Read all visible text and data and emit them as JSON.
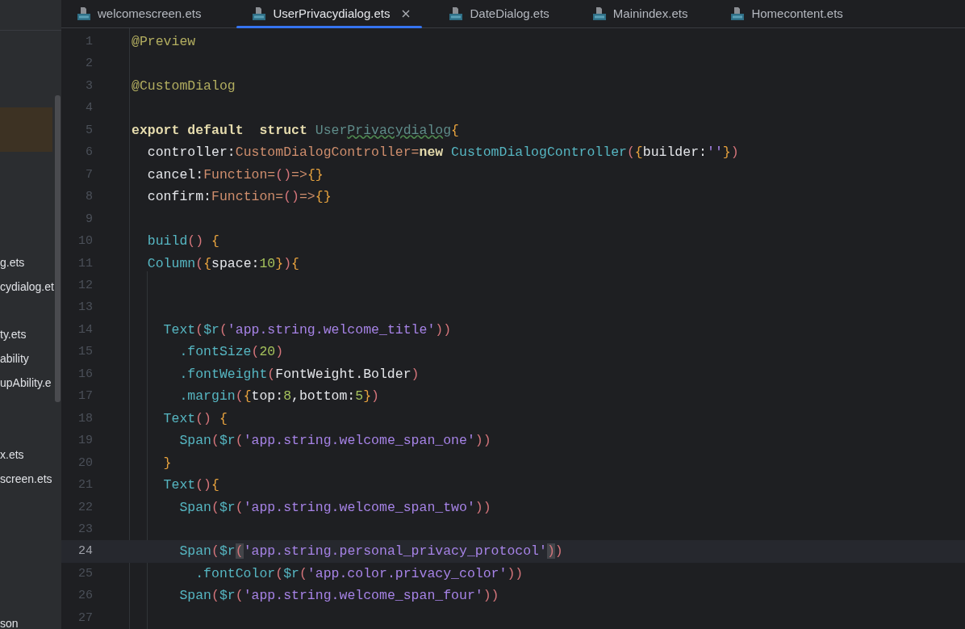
{
  "tabs": [
    {
      "label": "welcomescreen.ets",
      "selected": false
    },
    {
      "label": "UserPrivacydialog.ets",
      "selected": true
    },
    {
      "label": "DateDialog.ets",
      "selected": false
    },
    {
      "label": "Mainindex.ets",
      "selected": false
    },
    {
      "label": "Homecontent.ets",
      "selected": false
    }
  ],
  "sidebar": {
    "items": [
      {
        "label": "g.ets"
      },
      {
        "label": "cydialog.et"
      },
      {
        "label": "ty.ets"
      },
      {
        "label": "ability"
      },
      {
        "label": "upAbility.e"
      },
      {
        "label": "x.ets"
      },
      {
        "label": "screen.ets"
      },
      {
        "label": "son"
      }
    ]
  },
  "editor": {
    "lines": [
      {
        "number": "1",
        "current": false,
        "tokens": [
          {
            "text": "@Preview",
            "kind": "ann"
          }
        ]
      },
      {
        "number": "2",
        "current": false
      },
      {
        "number": "3",
        "current": false,
        "tokens": [
          {
            "text": "@CustomDialog",
            "kind": "ann"
          }
        ]
      },
      {
        "number": "4",
        "current": false
      },
      {
        "number": "5",
        "current": false,
        "tokens": [
          {
            "text": "export default  struct",
            "kind": "kw"
          },
          {
            "text": " User",
            "kind": "cls"
          },
          {
            "text": "Privacydialog",
            "kind": "warn"
          },
          {
            "text": "{",
            "kind": "brace"
          }
        ]
      },
      {
        "number": "6",
        "current": false,
        "tokens": [
          {
            "text": "  controller:",
            "kind": "plain"
          },
          {
            "text": "CustomDialogController",
            "kind": "type"
          },
          {
            "text": "=",
            "kind": "op"
          },
          {
            "text": "new",
            "kind": "kw"
          },
          {
            "text": " CustomDialogController",
            "kind": "fn"
          },
          {
            "text": "(",
            "kind": "paren"
          },
          {
            "text": "{",
            "kind": "brace"
          },
          {
            "text": "builder:",
            "kind": "plain"
          },
          {
            "text": "''",
            "kind": "str"
          },
          {
            "text": "}",
            "kind": "brace"
          },
          {
            "text": ")",
            "kind": "paren"
          }
        ]
      },
      {
        "number": "7",
        "current": false,
        "tokens": [
          {
            "text": "  cancel:",
            "kind": "plain"
          },
          {
            "text": "Function",
            "kind": "type"
          },
          {
            "text": "=",
            "kind": "op"
          },
          {
            "text": "()",
            "kind": "paren"
          },
          {
            "text": "=>",
            "kind": "op"
          },
          {
            "text": "{}",
            "kind": "brace"
          }
        ]
      },
      {
        "number": "8",
        "current": false,
        "tokens": [
          {
            "text": "  confirm:",
            "kind": "plain"
          },
          {
            "text": "Function",
            "kind": "type"
          },
          {
            "text": "=",
            "kind": "op"
          },
          {
            "text": "()",
            "kind": "paren"
          },
          {
            "text": "=>",
            "kind": "op"
          },
          {
            "text": "{}",
            "kind": "brace"
          }
        ]
      },
      {
        "number": "9",
        "current": false
      },
      {
        "number": "10",
        "current": false,
        "tokens": [
          {
            "text": "  build",
            "kind": "fn"
          },
          {
            "text": "()",
            "kind": "paren"
          },
          {
            "text": " {",
            "kind": "brace"
          }
        ]
      },
      {
        "number": "11",
        "current": false,
        "tokens": [
          {
            "text": "  Column",
            "kind": "fn"
          },
          {
            "text": "(",
            "kind": "paren"
          },
          {
            "text": "{",
            "kind": "brace"
          },
          {
            "text": "space:",
            "kind": "plain"
          },
          {
            "text": "10",
            "kind": "num"
          },
          {
            "text": "}",
            "kind": "brace"
          },
          {
            "text": ")",
            "kind": "paren"
          },
          {
            "text": "{",
            "kind": "brace"
          }
        ]
      },
      {
        "number": "12",
        "current": false
      },
      {
        "number": "13",
        "current": false
      },
      {
        "number": "14",
        "current": false,
        "tokens": [
          {
            "text": "    Text",
            "kind": "fn"
          },
          {
            "text": "(",
            "kind": "paren"
          },
          {
            "text": "$r",
            "kind": "fn"
          },
          {
            "text": "(",
            "kind": "paren"
          },
          {
            "text": "'app.string.welcome_title'",
            "kind": "str"
          },
          {
            "text": "))",
            "kind": "paren"
          }
        ]
      },
      {
        "number": "15",
        "current": false,
        "tokens": [
          {
            "text": "      .fontSize",
            "kind": "fn"
          },
          {
            "text": "(",
            "kind": "paren"
          },
          {
            "text": "20",
            "kind": "num"
          },
          {
            "text": ")",
            "kind": "paren"
          }
        ]
      },
      {
        "number": "16",
        "current": false,
        "tokens": [
          {
            "text": "      .fontWeight",
            "kind": "fn"
          },
          {
            "text": "(",
            "kind": "paren"
          },
          {
            "text": "FontWeight.Bolder",
            "kind": "plain"
          },
          {
            "text": ")",
            "kind": "paren"
          }
        ]
      },
      {
        "number": "17",
        "current": false,
        "tokens": [
          {
            "text": "      .margin",
            "kind": "fn"
          },
          {
            "text": "(",
            "kind": "paren"
          },
          {
            "text": "{",
            "kind": "brace"
          },
          {
            "text": "top:",
            "kind": "plain"
          },
          {
            "text": "8",
            "kind": "num"
          },
          {
            "text": ",bottom:",
            "kind": "plain"
          },
          {
            "text": "5",
            "kind": "num"
          },
          {
            "text": "}",
            "kind": "brace"
          },
          {
            "text": ")",
            "kind": "paren"
          }
        ]
      },
      {
        "number": "18",
        "current": false,
        "tokens": [
          {
            "text": "    Text",
            "kind": "fn"
          },
          {
            "text": "()",
            "kind": "paren"
          },
          {
            "text": " {",
            "kind": "brace"
          }
        ]
      },
      {
        "number": "19",
        "current": false,
        "tokens": [
          {
            "text": "      Span",
            "kind": "fn"
          },
          {
            "text": "(",
            "kind": "paren"
          },
          {
            "text": "$r",
            "kind": "fn"
          },
          {
            "text": "(",
            "kind": "paren"
          },
          {
            "text": "'app.string.welcome_span_one'",
            "kind": "str"
          },
          {
            "text": "))",
            "kind": "paren"
          }
        ]
      },
      {
        "number": "20",
        "current": false,
        "tokens": [
          {
            "text": "    }",
            "kind": "brace"
          }
        ]
      },
      {
        "number": "21",
        "current": false,
        "tokens": [
          {
            "text": "    Text",
            "kind": "fn"
          },
          {
            "text": "()",
            "kind": "paren"
          },
          {
            "text": "{",
            "kind": "brace"
          }
        ]
      },
      {
        "number": "22",
        "current": false,
        "tokens": [
          {
            "text": "      Span",
            "kind": "fn"
          },
          {
            "text": "(",
            "kind": "paren"
          },
          {
            "text": "$r",
            "kind": "fn"
          },
          {
            "text": "(",
            "kind": "paren"
          },
          {
            "text": "'app.string.welcome_span_two'",
            "kind": "str"
          },
          {
            "text": "))",
            "kind": "paren"
          }
        ]
      },
      {
        "number": "23",
        "current": false
      },
      {
        "number": "24",
        "current": true,
        "tokens": [
          {
            "text": "      Span",
            "kind": "fn"
          },
          {
            "text": "(",
            "kind": "paren"
          },
          {
            "text": "$r",
            "kind": "fn"
          },
          {
            "text": "(",
            "kind": "match"
          },
          {
            "text": "'app.string.personal_privacy_protocol'",
            "kind": "str"
          },
          {
            "text": ")",
            "kind": "match"
          },
          {
            "text": ")",
            "kind": "paren"
          }
        ]
      },
      {
        "number": "25",
        "current": false,
        "tokens": [
          {
            "text": "        .fontColor",
            "kind": "fn"
          },
          {
            "text": "(",
            "kind": "paren"
          },
          {
            "text": "$r",
            "kind": "fn"
          },
          {
            "text": "(",
            "kind": "paren"
          },
          {
            "text": "'app.color.privacy_color'",
            "kind": "str"
          },
          {
            "text": "))",
            "kind": "paren"
          }
        ]
      },
      {
        "number": "26",
        "current": false,
        "tokens": [
          {
            "text": "      Span",
            "kind": "fn"
          },
          {
            "text": "(",
            "kind": "paren"
          },
          {
            "text": "$r",
            "kind": "fn"
          },
          {
            "text": "(",
            "kind": "paren"
          },
          {
            "text": "'app.string.welcome_span_four'",
            "kind": "str"
          },
          {
            "text": "))",
            "kind": "paren"
          }
        ]
      },
      {
        "number": "27",
        "current": false
      }
    ]
  }
}
